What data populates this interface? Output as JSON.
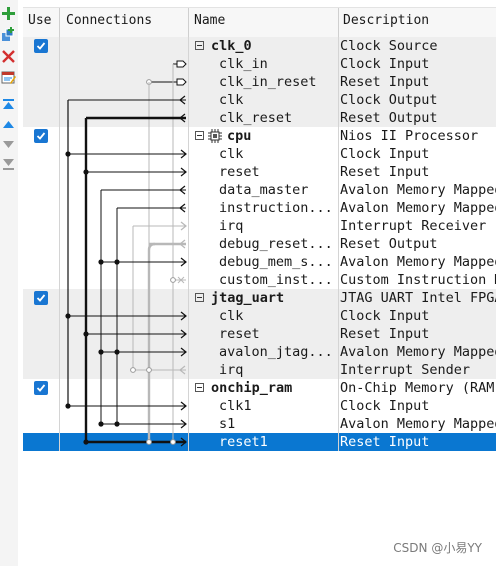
{
  "header": {
    "use": "Use",
    "connections": "Connections",
    "name": "Name",
    "description": "Description"
  },
  "toolbar": {
    "icons": [
      "add-icon",
      "add-connection-icon",
      "remove-icon",
      "edit-icon",
      "move-to-top-icon",
      "move-up-icon",
      "move-down-icon",
      "move-to-bottom-icon"
    ]
  },
  "rows": [
    {
      "name": "clk_0",
      "description": "Clock Source",
      "type": "module",
      "checked": true
    },
    {
      "name": "clk_in",
      "description": "Clock Input",
      "type": "port"
    },
    {
      "name": "clk_in_reset",
      "description": "Reset Input",
      "type": "port"
    },
    {
      "name": "clk",
      "description": "Clock Output",
      "type": "port"
    },
    {
      "name": "clk_reset",
      "description": "Reset Output",
      "type": "port"
    },
    {
      "name": "cpu",
      "description": "Nios II Processor",
      "type": "module",
      "checked": true,
      "icon": "processor-icon"
    },
    {
      "name": "clk",
      "description": "Clock Input",
      "type": "port"
    },
    {
      "name": "reset",
      "description": "Reset Input",
      "type": "port"
    },
    {
      "name": "data_master",
      "description": "Avalon Memory Mapped",
      "type": "port"
    },
    {
      "name": "instruction...",
      "description": "Avalon Memory Mapped",
      "type": "port"
    },
    {
      "name": "irq",
      "description": "Interrupt Receiver",
      "type": "port"
    },
    {
      "name": "debug_reset...",
      "description": "Reset Output",
      "type": "port"
    },
    {
      "name": "debug_mem_s...",
      "description": "Avalon Memory Mapped",
      "type": "port"
    },
    {
      "name": "custom_inst...",
      "description": "Custom Instruction M",
      "type": "port"
    },
    {
      "name": "jtag_uart",
      "description": "JTAG UART Intel FPGA",
      "type": "module",
      "checked": true
    },
    {
      "name": "clk",
      "description": "Clock Input",
      "type": "port"
    },
    {
      "name": "reset",
      "description": "Reset Input",
      "type": "port"
    },
    {
      "name": "avalon_jtag...",
      "description": "Avalon Memory Mapped",
      "type": "port"
    },
    {
      "name": "irq",
      "description": "Interrupt Sender",
      "type": "port"
    },
    {
      "name": "onchip_ram",
      "description": "On-Chip Memory (RAM",
      "type": "module",
      "checked": true
    },
    {
      "name": "clk1",
      "description": "Clock Input",
      "type": "port"
    },
    {
      "name": "s1",
      "description": "Avalon Memory Mapped",
      "type": "port"
    },
    {
      "name": "reset1",
      "description": "Reset Input",
      "type": "port",
      "selected": true
    }
  ],
  "watermark": "CSDN @小易YY",
  "colors": {
    "selection": "#0a77d1",
    "checkbox": "#1976d2",
    "add": "#2e9e3a",
    "remove": "#d32f2f",
    "move": "#1e88e5"
  }
}
